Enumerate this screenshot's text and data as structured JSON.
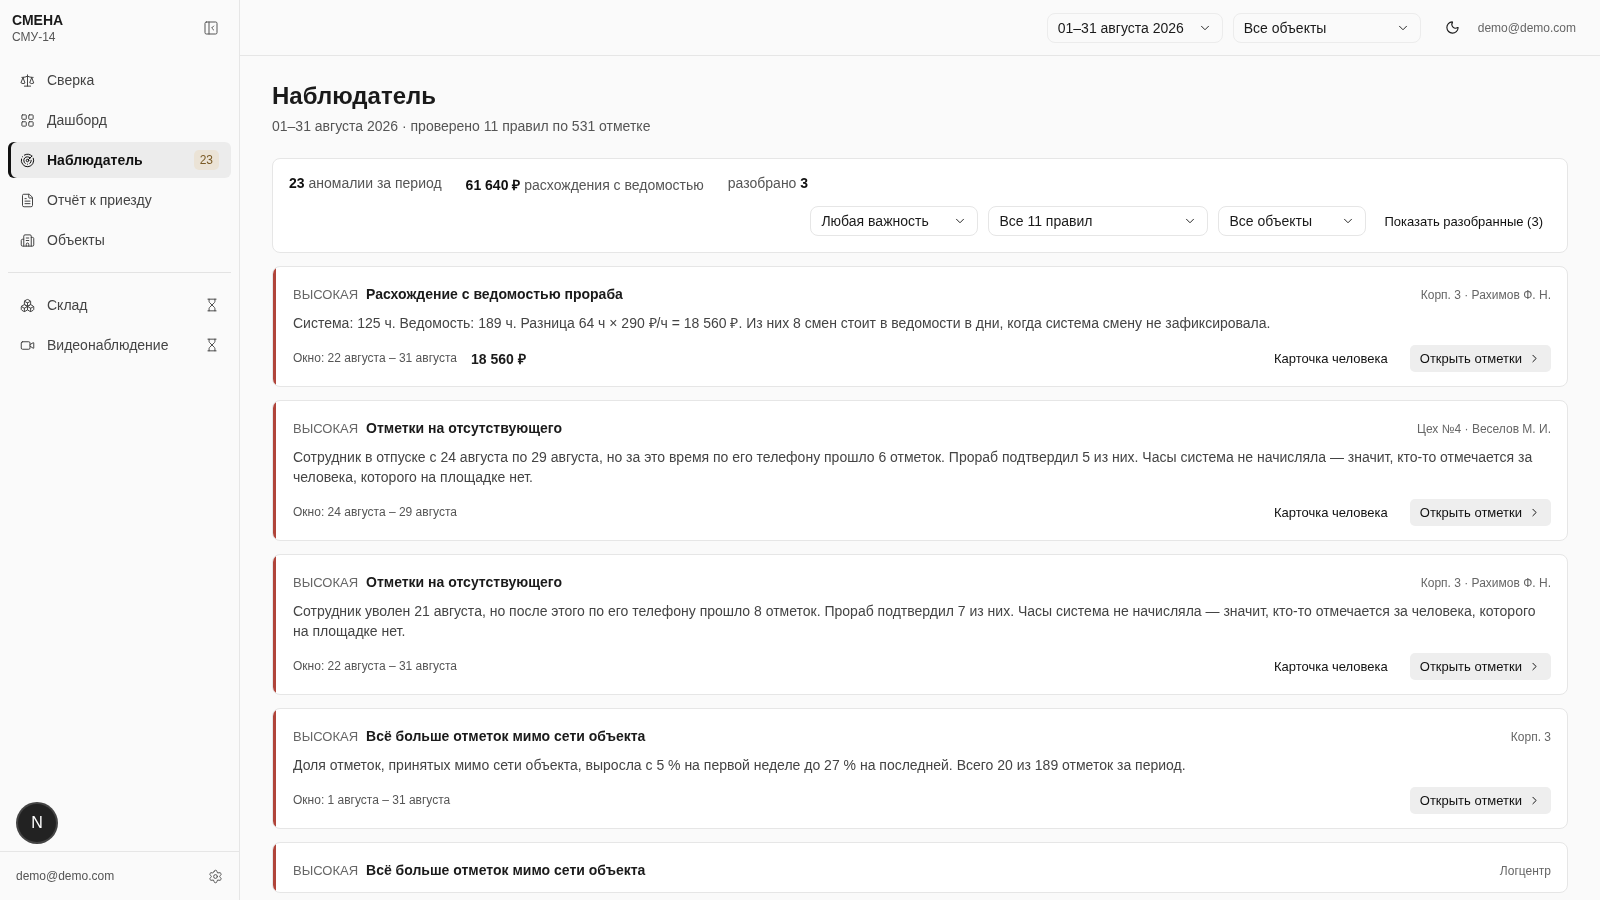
{
  "sidebar": {
    "brand": "СМЕНА",
    "org": "СМУ-14",
    "items": [
      {
        "label": "Сверка",
        "selected": false
      },
      {
        "label": "Дашборд",
        "selected": false
      },
      {
        "label": "Наблюдатель",
        "selected": true,
        "badge": "23"
      },
      {
        "label": "Отчёт к приезду",
        "selected": false
      },
      {
        "label": "Объекты",
        "selected": false
      }
    ],
    "secondary_items": [
      {
        "label": "Склад",
        "selected": false,
        "pending": true
      },
      {
        "label": "Видеонаблюдение",
        "selected": false,
        "pending": true
      }
    ],
    "user_email": "demo@demo.com",
    "dev_badge": "N"
  },
  "header": {
    "period": "01–31 августа 2026",
    "object": "Все объекты",
    "user_email": "demo@demo.com"
  },
  "page": {
    "title": "Наблюдатель",
    "subtitle": "01–31 августа 2026 · проверено 11 правил по 531 отметке"
  },
  "summary": {
    "stats": [
      "**23** аномалии за период",
      "**61 640 ₽** расхождения с ведомостью",
      "разобрано **3**"
    ],
    "filters": [
      "Любая важность",
      "Все 11 правил",
      "Все объекты"
    ],
    "show_resolved": "Показать разобранные (3)"
  },
  "anomalies": [
    {
      "severity": "ВЫСОКАЯ",
      "color": "#b0443a",
      "title": "Расхождение с ведомостью прораба",
      "meta": "Корп. 3 · Рахимов Ф. Н.",
      "text": "Система: 125 ч. Ведомость: 189 ч. Разница 64 ч × 290 ₽/ч = 18 560 ₽. Из них 8 смен стоит в ведомости в дни, когда система смену не зафиксировала.",
      "window": "Окно: 22 августа – 31 августа",
      "amount": "18 560 ₽",
      "person_link": "Карточка человека",
      "open_button": "Открыть отметки"
    },
    {
      "severity": "ВЫСОКАЯ",
      "color": "#b0443a",
      "title": "Отметки на отсутствующего",
      "meta": "Цех №4 · Веселов М. И.",
      "text": "Сотрудник в отпуске с 24 августа по 29 августа, но за это время по его телефону прошло 6 отметок. Прораб подтвердил 5 из них. Часы система не начисляла — значит, кто-то отмечается за человека, которого на площадке нет.",
      "window": "Окно: 24 августа – 29 августа",
      "person_link": "Карточка человека",
      "open_button": "Открыть отметки"
    },
    {
      "severity": "ВЫСОКАЯ",
      "color": "#b0443a",
      "title": "Отметки на отсутствующего",
      "meta": "Корп. 3 · Рахимов Ф. Н.",
      "text": "Сотрудник уволен 21 августа, но после этого по его телефону прошло 8 отметок. Прораб подтвердил 7 из них. Часы система не начисляла — значит, кто-то отмечается за человека, которого на площадке нет.",
      "window": "Окно: 22 августа – 31 августа",
      "person_link": "Карточка человека",
      "open_button": "Открыть отметки"
    },
    {
      "severity": "ВЫСОКАЯ",
      "color": "#b0443a",
      "title": "Всё больше отметок мимо сети объекта",
      "meta": "Корп. 3",
      "text": "Доля отметок, принятых мимо сети объекта, выросла с 5 % на первой неделе до 27 % на последней. Всего 20 из 189 отметок за период.",
      "window": "Окно: 1 августа – 31 августа",
      "open_button": "Открыть отметки"
    },
    {
      "severity": "ВЫСОКАЯ",
      "color": "#b0443a",
      "title": "Всё больше отметок мимо сети объекта",
      "meta": "Логцентр"
    }
  ]
}
